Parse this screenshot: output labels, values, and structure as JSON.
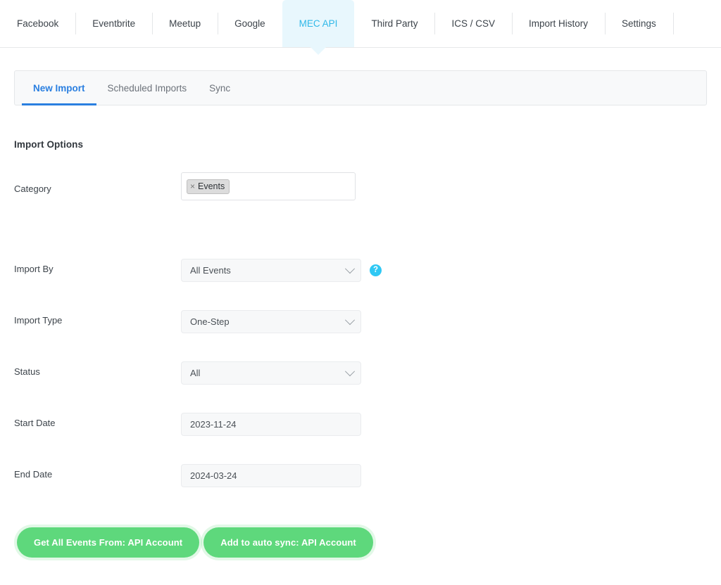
{
  "topnav": {
    "items": [
      {
        "label": "Facebook",
        "active": false
      },
      {
        "label": "Eventbrite",
        "active": false
      },
      {
        "label": "Meetup",
        "active": false
      },
      {
        "label": "Google",
        "active": false
      },
      {
        "label": "MEC API",
        "active": true
      },
      {
        "label": "Third Party",
        "active": false
      },
      {
        "label": "ICS / CSV",
        "active": false
      },
      {
        "label": "Import History",
        "active": false
      },
      {
        "label": "Settings",
        "active": false
      }
    ],
    "active_color": "#2fb8e8",
    "active_background": "#e8f7fd"
  },
  "subtabs": {
    "items": [
      {
        "label": "New Import",
        "active": true
      },
      {
        "label": "Scheduled Imports",
        "active": false
      },
      {
        "label": "Sync",
        "active": false
      }
    ],
    "active_color": "#2a7fe0"
  },
  "form": {
    "section_title": "Import Options",
    "category": {
      "label": "Category",
      "tags": [
        {
          "remove_glyph": "×",
          "label": "Events"
        }
      ]
    },
    "import_by": {
      "label": "Import By",
      "value": "All Events",
      "help_glyph": "?",
      "help_color": "#2fc8f4"
    },
    "import_type": {
      "label": "Import Type",
      "value": "One-Step"
    },
    "status": {
      "label": "Status",
      "value": "All"
    },
    "start_date": {
      "label": "Start Date",
      "value": "2023-11-24"
    },
    "end_date": {
      "label": "End Date",
      "value": "2024-03-24"
    },
    "buttons": {
      "get_events": "Get All Events From: API Account",
      "auto_sync": "Add to auto sync: API Account",
      "color": "#5ed87c"
    }
  }
}
